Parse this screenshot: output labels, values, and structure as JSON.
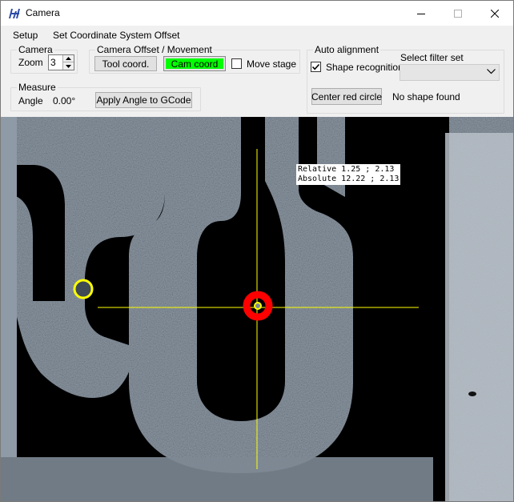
{
  "window": {
    "title": "Camera",
    "controls": {
      "minimize": "minimize-icon",
      "maximize": "maximize-icon",
      "close": "close-icon"
    }
  },
  "menu": [
    "Setup",
    "Set Coordinate System Offset"
  ],
  "camera_group": {
    "title": "Camera",
    "zoom_label": "Zoom",
    "zoom_value": "3"
  },
  "offset_group": {
    "title": "Camera Offset / Movement",
    "tool_button": "Tool coord.",
    "cam_button": "Cam coord",
    "move_stage_label": "Move stage",
    "move_stage_checked": false
  },
  "measure_group": {
    "title": "Measure",
    "angle_label": "Angle",
    "angle_value": "0.00°",
    "apply_button": "Apply Angle to GCode"
  },
  "auto_group": {
    "title": "Auto alignment",
    "shape_label": "Shape recognition",
    "shape_checked": true,
    "filter_label": "Select filter set",
    "filter_value": "",
    "center_button": "Center red circle",
    "status": "No shape found"
  },
  "camera_view": {
    "relative_text": "Relative 1.25 ; 2.13",
    "absolute_text": "Absolute 12.22 ; 2.13",
    "crosshair_color": "#ffff00",
    "red_marker_color": "#ff0000",
    "yellow_marker_color": "#ffff00"
  },
  "colors": {
    "cam_button_active": "#00ff00",
    "background": "#f0f0f0"
  }
}
